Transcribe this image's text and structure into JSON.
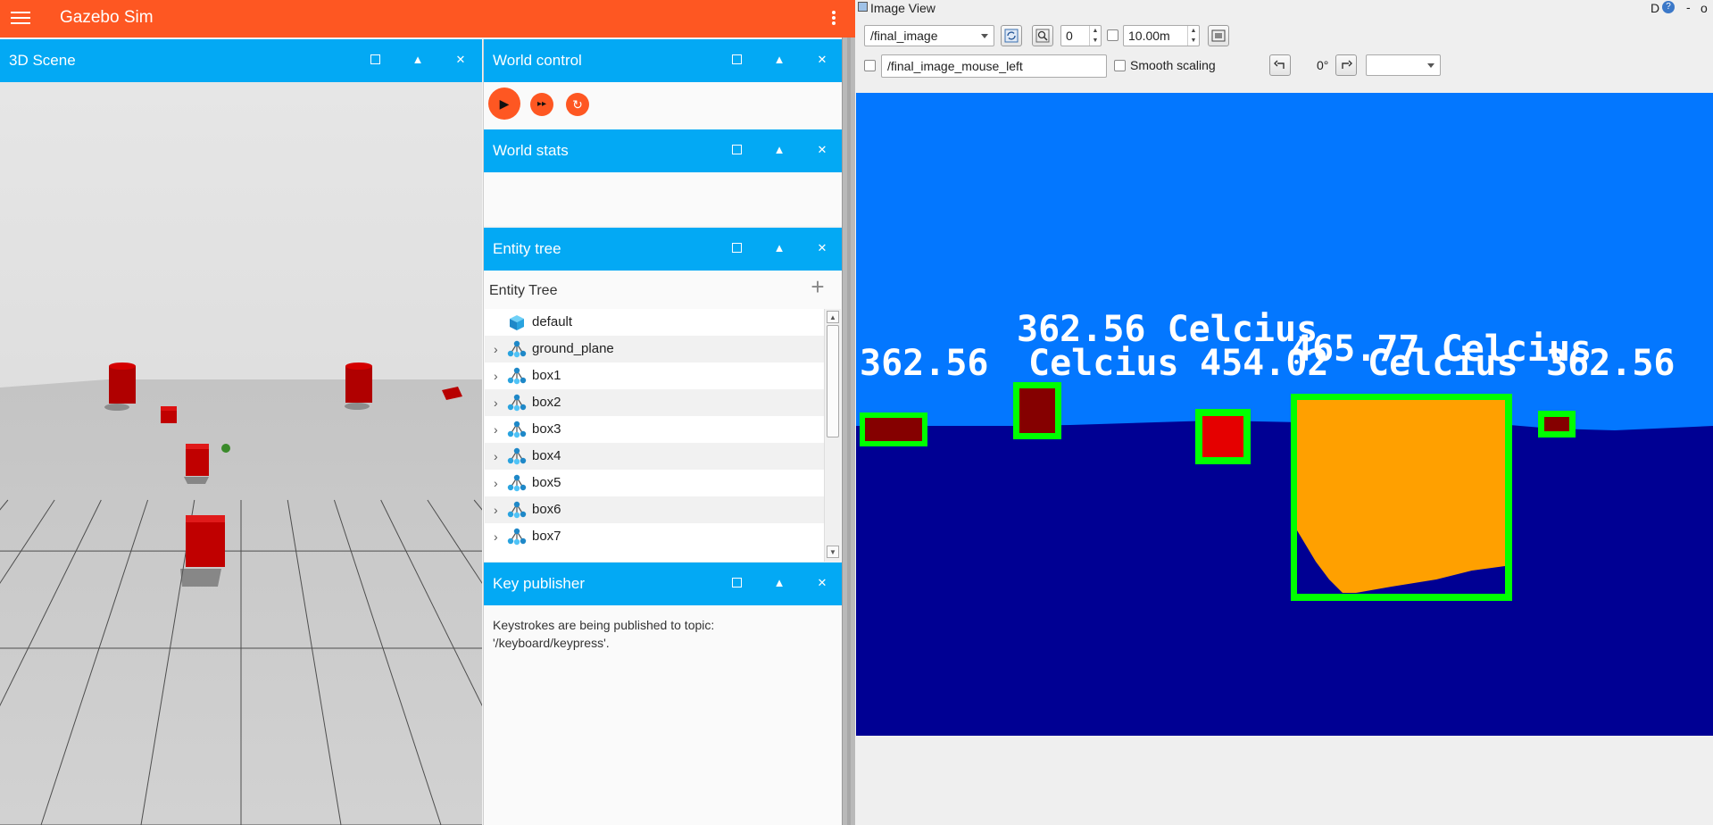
{
  "gazebo": {
    "app_title": "Gazebo Sim",
    "panels": {
      "scene": {
        "title": "3D Scene"
      },
      "world_control": {
        "title": "World control"
      },
      "world_stats": {
        "title": "World stats"
      },
      "entity_tree": {
        "title": "Entity tree",
        "label": "Entity Tree"
      },
      "key_publisher": {
        "title": "Key publisher",
        "text": "Keystrokes are being published to topic: '/keyboard/keypress'."
      }
    },
    "panel_buttons": {
      "max": "",
      "collapse": "▲",
      "close": "✕"
    },
    "world_control_buttons": {
      "play": "▶",
      "step": "▸▸",
      "reset": "↻"
    },
    "entities": [
      {
        "name": "default",
        "expandable": false
      },
      {
        "name": "ground_plane",
        "expandable": true
      },
      {
        "name": "box1",
        "expandable": true
      },
      {
        "name": "box2",
        "expandable": true
      },
      {
        "name": "box3",
        "expandable": true
      },
      {
        "name": "box4",
        "expandable": true
      },
      {
        "name": "box5",
        "expandable": true
      },
      {
        "name": "box6",
        "expandable": true
      },
      {
        "name": "box7",
        "expandable": true
      }
    ],
    "colors": {
      "top_bar": "#fe5722",
      "panel_header": "#03a9f4",
      "box": "#cc0000"
    }
  },
  "image_view": {
    "window_title": "Image View",
    "title_flags": {
      "d": "D",
      "help": "?",
      "minimize": "-",
      "close": "o"
    },
    "topic": "/final_image",
    "spin_value": "0",
    "max_range": "10.00m",
    "mouse_topic": "/final_image_mouse_left",
    "smooth_scaling_label": "Smooth scaling",
    "rotation": "0°",
    "colormap_value": "",
    "image_texts": [
      "362.56  Celcius",
      "465.77 Celcius",
      "362.56",
      "Celcius",
      "454.02",
      "Celcius",
      "362.56"
    ],
    "colors": {
      "sky": "#0377ff",
      "ground": "#000093",
      "box_dark": "#850000",
      "box_red": "#e50000",
      "box_orange": "#ffa000",
      "bbox": "#00ff00"
    }
  }
}
